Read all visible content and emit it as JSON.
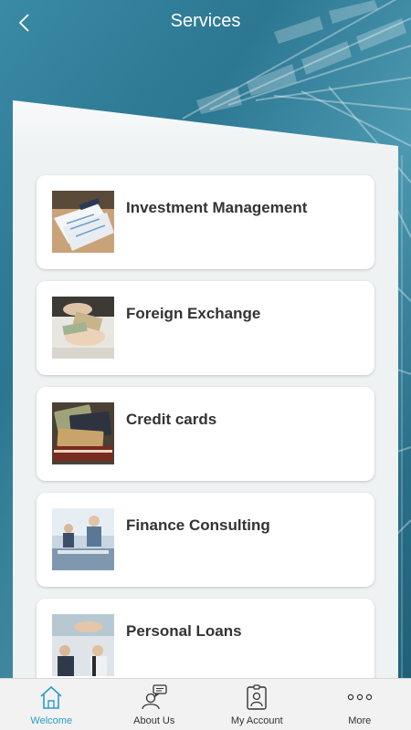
{
  "header": {
    "title": "Services",
    "back_icon": "chevron-left-icon"
  },
  "services": [
    {
      "label": "Investment Management",
      "image": "investment-documents-image"
    },
    {
      "label": "Foreign Exchange",
      "image": "money-exchange-image"
    },
    {
      "label": "Credit cards",
      "image": "credit-cards-image"
    },
    {
      "label": "Finance Consulting",
      "image": "business-meeting-image"
    },
    {
      "label": "Personal Loans",
      "image": "people-handshake-image"
    }
  ],
  "tabbar": {
    "tabs": [
      {
        "label": "Welcome",
        "icon": "home-icon",
        "active": true
      },
      {
        "label": "About Us",
        "icon": "person-chat-icon",
        "active": false
      },
      {
        "label": "My Account",
        "icon": "id-badge-icon",
        "active": false
      },
      {
        "label": "More",
        "icon": "more-dots-icon",
        "active": false
      }
    ]
  },
  "colors": {
    "accent": "#2a9cc8",
    "header_text": "#ffffff",
    "card_text": "#333333"
  }
}
